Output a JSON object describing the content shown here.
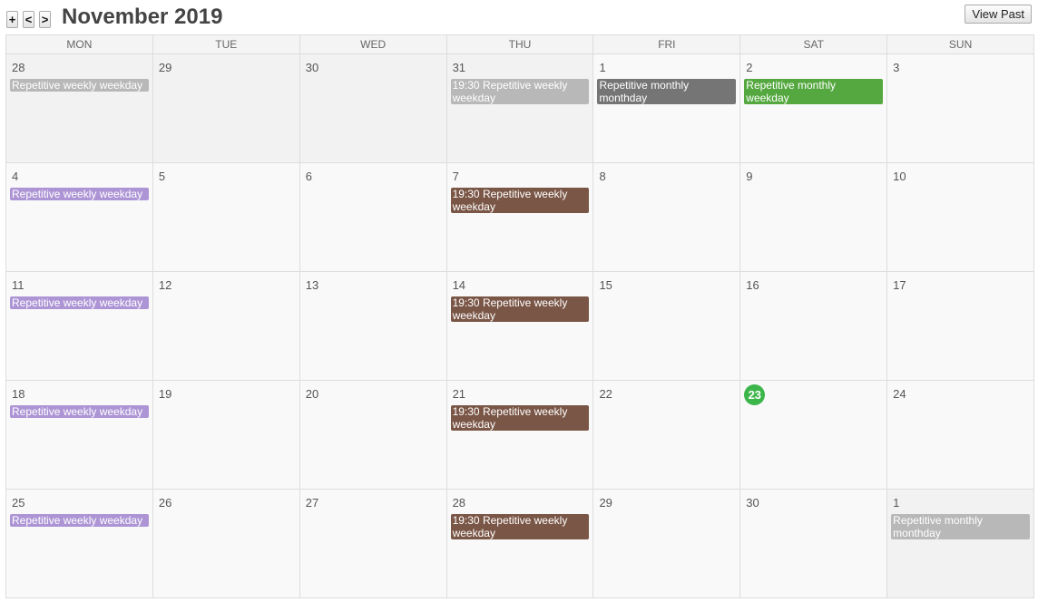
{
  "toolbar": {
    "add_label": "+",
    "prev_label": "<",
    "next_label": ">",
    "title": "November 2019",
    "view_past_label": "View Past"
  },
  "colors": {
    "today": "#3cb54a",
    "past_event": "#b8b8b8",
    "purple_event": "#ad95d5",
    "brown_event": "#7a5646",
    "dark_gray_event": "#757575",
    "green_event": "#54a83f"
  },
  "weekdays": [
    "MON",
    "TUE",
    "WED",
    "THU",
    "FRI",
    "SAT",
    "SUN"
  ],
  "weeks": [
    {
      "days": [
        {
          "num": "28",
          "other": true,
          "events": [
            {
              "text": "Repetitive weekly weekday",
              "color": "#b8b8b8"
            }
          ]
        },
        {
          "num": "29",
          "other": true,
          "events": []
        },
        {
          "num": "30",
          "other": true,
          "events": []
        },
        {
          "num": "31",
          "other": true,
          "events": [
            {
              "text": "19:30 Repetitive weekly weekday",
              "color": "#b8b8b8"
            }
          ]
        },
        {
          "num": "1",
          "other": false,
          "events": [
            {
              "text": "Repetitive monthly monthday",
              "color": "#757575"
            }
          ]
        },
        {
          "num": "2",
          "other": false,
          "events": [
            {
              "text": "Repetitive monthly weekday",
              "color": "#54a83f"
            }
          ]
        },
        {
          "num": "3",
          "other": false,
          "events": []
        }
      ]
    },
    {
      "days": [
        {
          "num": "4",
          "other": false,
          "events": [
            {
              "text": "Repetitive weekly weekday",
              "color": "#ad95d5"
            }
          ]
        },
        {
          "num": "5",
          "other": false,
          "events": []
        },
        {
          "num": "6",
          "other": false,
          "events": []
        },
        {
          "num": "7",
          "other": false,
          "events": [
            {
              "text": "19:30 Repetitive weekly weekday",
              "color": "#7a5646"
            }
          ]
        },
        {
          "num": "8",
          "other": false,
          "events": []
        },
        {
          "num": "9",
          "other": false,
          "events": []
        },
        {
          "num": "10",
          "other": false,
          "events": []
        }
      ]
    },
    {
      "days": [
        {
          "num": "11",
          "other": false,
          "events": [
            {
              "text": "Repetitive weekly weekday",
              "color": "#ad95d5"
            }
          ]
        },
        {
          "num": "12",
          "other": false,
          "events": []
        },
        {
          "num": "13",
          "other": false,
          "events": []
        },
        {
          "num": "14",
          "other": false,
          "events": [
            {
              "text": "19:30 Repetitive weekly weekday",
              "color": "#7a5646"
            }
          ]
        },
        {
          "num": "15",
          "other": false,
          "events": []
        },
        {
          "num": "16",
          "other": false,
          "events": []
        },
        {
          "num": "17",
          "other": false,
          "events": []
        }
      ]
    },
    {
      "days": [
        {
          "num": "18",
          "other": false,
          "events": [
            {
              "text": "Repetitive weekly weekday",
              "color": "#ad95d5"
            }
          ]
        },
        {
          "num": "19",
          "other": false,
          "events": []
        },
        {
          "num": "20",
          "other": false,
          "events": []
        },
        {
          "num": "21",
          "other": false,
          "events": [
            {
              "text": "19:30 Repetitive weekly weekday",
              "color": "#7a5646"
            }
          ]
        },
        {
          "num": "22",
          "other": false,
          "events": []
        },
        {
          "num": "23",
          "other": false,
          "today": true,
          "events": []
        },
        {
          "num": "24",
          "other": false,
          "events": []
        }
      ]
    },
    {
      "days": [
        {
          "num": "25",
          "other": false,
          "events": [
            {
              "text": "Repetitive weekly weekday",
              "color": "#ad95d5"
            }
          ]
        },
        {
          "num": "26",
          "other": false,
          "events": []
        },
        {
          "num": "27",
          "other": false,
          "events": []
        },
        {
          "num": "28",
          "other": false,
          "events": [
            {
              "text": "19:30 Repetitive weekly weekday",
              "color": "#7a5646"
            }
          ]
        },
        {
          "num": "29",
          "other": false,
          "events": []
        },
        {
          "num": "30",
          "other": false,
          "events": []
        },
        {
          "num": "1",
          "other": true,
          "events": [
            {
              "text": "Repetitive monthly monthday",
              "color": "#b8b8b8"
            }
          ]
        }
      ]
    }
  ]
}
